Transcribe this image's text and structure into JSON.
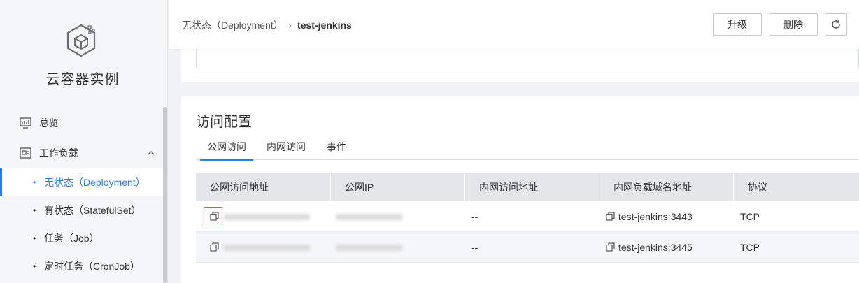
{
  "sidebar": {
    "app_title": "云容器实例",
    "overview": "总览",
    "workload": "工作负载",
    "sub_items": [
      {
        "dot": "•",
        "label": "无状态（Deployment）"
      },
      {
        "dot": "•",
        "label": "有状态（StatefulSet）"
      },
      {
        "dot": "•",
        "label": "任务（Job）"
      },
      {
        "dot": "•",
        "label": "定时任务（CronJob）"
      }
    ]
  },
  "header": {
    "breadcrumb_parent": "无状态（Deployment）",
    "breadcrumb_sep": "›",
    "breadcrumb_current": "test-jenkins",
    "upgrade_label": "升级",
    "delete_label": "删除"
  },
  "access": {
    "title": "访问配置",
    "tabs": [
      "公网访问",
      "内网访问",
      "事件"
    ],
    "columns": [
      "公网访问地址",
      "公网IP",
      "内网访问地址",
      "内网负载域名地址",
      "协议"
    ],
    "rows": [
      {
        "internal": "--",
        "domain": "test-jenkins:3443",
        "protocol": "TCP"
      },
      {
        "internal": "--",
        "domain": "test-jenkins:3445",
        "protocol": "TCP"
      }
    ]
  },
  "colors": {
    "accent": "#2d7be5",
    "highlight": "#e0524f"
  }
}
